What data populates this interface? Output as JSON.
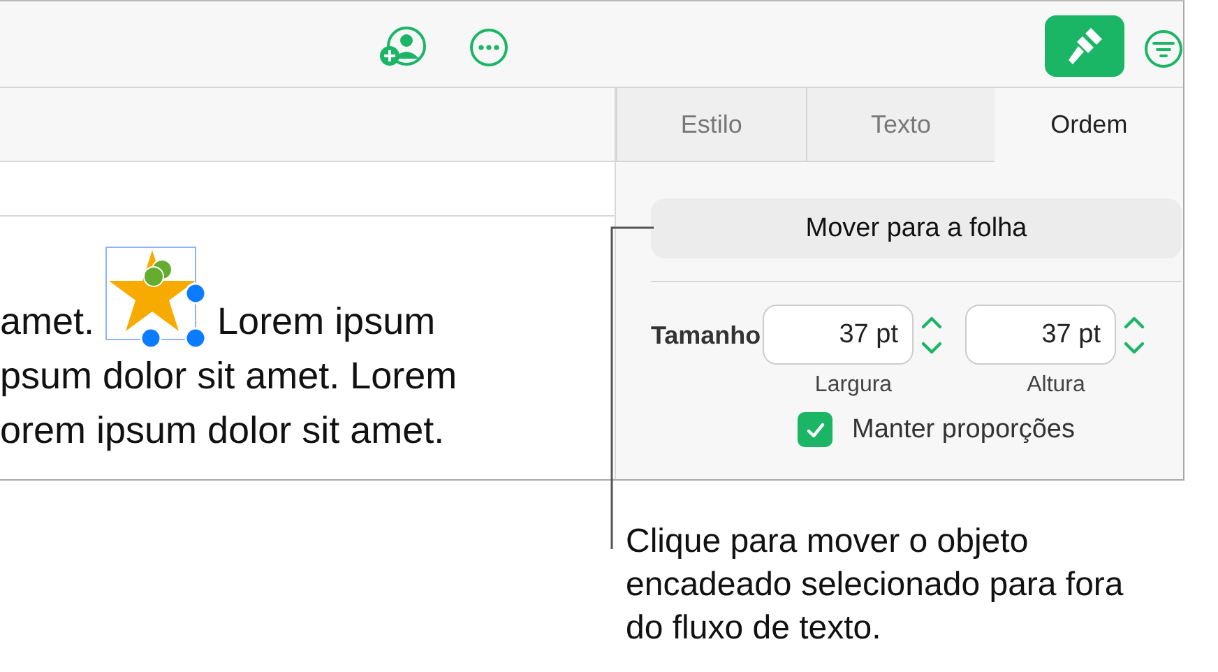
{
  "toolbar": {
    "format_button": {
      "on": true
    }
  },
  "tabs": [
    {
      "label": "Estilo",
      "selected": false
    },
    {
      "label": "Texto",
      "selected": false
    },
    {
      "label": "Ordem",
      "selected": true
    }
  ],
  "document": {
    "first_line_before": "amet.",
    "first_line_after": "Lorem ipsum",
    "inline_object": {
      "selected": true
    },
    "lines": [
      "psum dolor sit amet. Lorem",
      "orem ipsum dolor sit amet."
    ]
  },
  "panel": {
    "move_button": "Mover para a folha",
    "size_label": "Tamanho",
    "fields": [
      {
        "value": "37 pt",
        "caption": "Largura"
      },
      {
        "value": "37 pt",
        "caption": "Altura"
      }
    ],
    "checkbox": {
      "label": "Manter proporções",
      "checked": true
    }
  },
  "callout": "Clique para mover o objeto encadeado selecionado para fora do fluxo de texto."
}
